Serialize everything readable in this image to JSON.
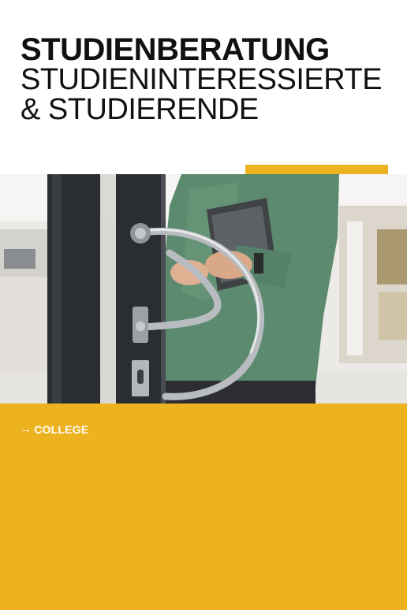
{
  "header": {
    "title": "STUDIENBERATUNG",
    "subtitle_line1": "STUDIENINTERESSIERTE",
    "subtitle_line2": "& STUDIERENDE"
  },
  "colors": {
    "accent": "#ecb21f",
    "text": "#111111",
    "background": "#ffffff"
  },
  "photo": {
    "alt_name": "door-handle-photo"
  },
  "panel": {
    "link_label": "COLLEGE",
    "link_icon": "arrow-right-icon"
  }
}
